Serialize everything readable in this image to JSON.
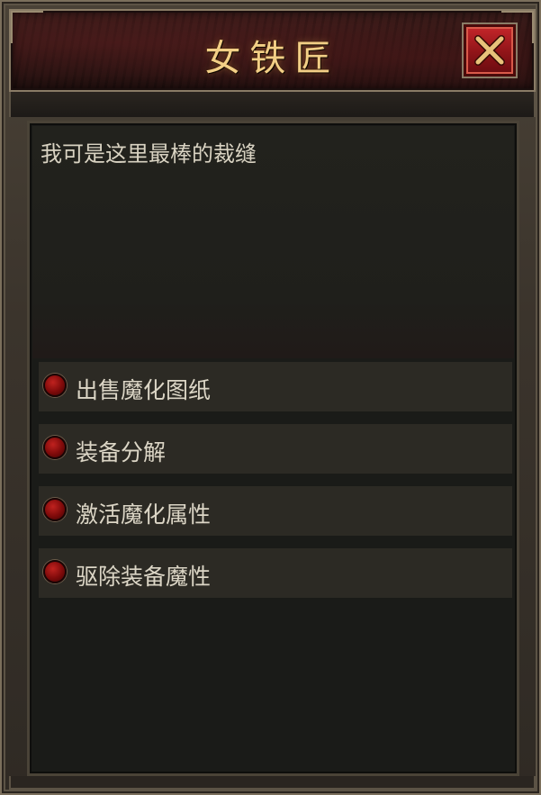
{
  "window": {
    "title": "女铁匠",
    "close_icon": "close-x-icon"
  },
  "dialog": {
    "text": "我可是这里最棒的裁缝"
  },
  "options": [
    {
      "label": "出售魔化图纸",
      "icon": "red-orb-bullet-icon"
    },
    {
      "label": "装备分解",
      "icon": "red-orb-bullet-icon"
    },
    {
      "label": "激活魔化属性",
      "icon": "red-orb-bullet-icon"
    },
    {
      "label": "驱除装备魔性",
      "icon": "red-orb-bullet-icon"
    }
  ],
  "colors": {
    "title_gold": "#f2cf86",
    "title_bar_red": "#3e1d1b",
    "close_button_red": "#c4262a",
    "panel_bg": "#1a1b18",
    "option_bg": "#2c2a24",
    "text": "#d9d3c2"
  }
}
